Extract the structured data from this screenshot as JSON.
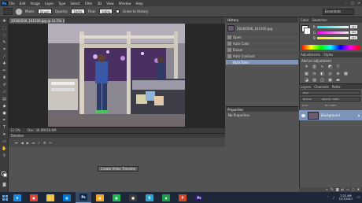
{
  "app": {
    "logo": "Ps",
    "menu": [
      "File",
      "Edit",
      "Image",
      "Layer",
      "Type",
      "Select",
      "Filter",
      "3D",
      "View",
      "Window",
      "Help"
    ],
    "window_controls": [
      "–",
      "□",
      "✕"
    ]
  },
  "options_bar": {
    "mode_label": "Mode:",
    "mode_value": "Brush",
    "opacity_label": "Opacity:",
    "opacity_value": "100%",
    "flow_label": "Flow:",
    "flow_value": "100%",
    "erase_history_label": "Erase to History",
    "workspace_value": "Essentials"
  },
  "document": {
    "tab_title": "20160506_161500.jpg @ 12.5% (RGB/8) ×",
    "zoom": "12.5%",
    "doc_size": "Doc: 36.6M/36.6M"
  },
  "timeline": {
    "title": "Timeline",
    "create_button": "Create Video Timeline"
  },
  "history": {
    "title": "History",
    "snapshot_name": "20160506_161500.jpg",
    "items": [
      "Open",
      "Auto Color",
      "Eraser",
      "Auto Contrast",
      "Auto Tone"
    ],
    "active_index": 4
  },
  "properties": {
    "title": "Properties",
    "text": "No Properties"
  },
  "color_panel": {
    "tabs": [
      "Color",
      "Swatches"
    ],
    "sliders": [
      {
        "label": "R",
        "value": "240",
        "color": "#f0f0f0"
      },
      {
        "label": "G",
        "value": "240",
        "color": "#f0f0f0"
      },
      {
        "label": "B",
        "value": "240",
        "color": "#f0f0f0"
      }
    ]
  },
  "adjustments": {
    "tabs": [
      "Adjustments",
      "Styles"
    ],
    "title": "Add an adjustment"
  },
  "layers": {
    "tabs": [
      "Layers",
      "Channels",
      "Paths"
    ],
    "filter_label": "Kind",
    "mode_label": "Normal",
    "opacity_label": "Opacity: 100%",
    "lock_label": "Lock:",
    "fill_label": "Fill: 100%",
    "layer_name": "Background"
  },
  "taskbar": {
    "items": [
      {
        "name": "ie",
        "glyph": "e",
        "color": "#1e88e5"
      },
      {
        "name": "chrome",
        "glyph": "●",
        "color": "#db4437"
      },
      {
        "name": "explorer",
        "glyph": "▭",
        "color": "#f4c542"
      },
      {
        "name": "store",
        "glyph": "▦",
        "color": "#0078d7"
      },
      {
        "name": "photoshop",
        "glyph": "Ps",
        "color": "#0d2a4a"
      },
      {
        "name": "bulb",
        "glyph": "●",
        "color": "#f5a623"
      },
      {
        "name": "spotify",
        "glyph": "●",
        "color": "#1db954"
      },
      {
        "name": "app-dark",
        "glyph": "■",
        "color": "#3a3a3a"
      },
      {
        "name": "kodi",
        "glyph": "K",
        "color": "#2fa4d0"
      },
      {
        "name": "app-green",
        "glyph": "◆",
        "color": "#1e9e4a"
      },
      {
        "name": "powerpoint",
        "glyph": "P",
        "color": "#d24726"
      },
      {
        "name": "photoshop2",
        "glyph": "Ps",
        "color": "#2a1a6a"
      }
    ],
    "active_index": 4,
    "time": "7:22 AM",
    "date": "7/17/2017"
  }
}
